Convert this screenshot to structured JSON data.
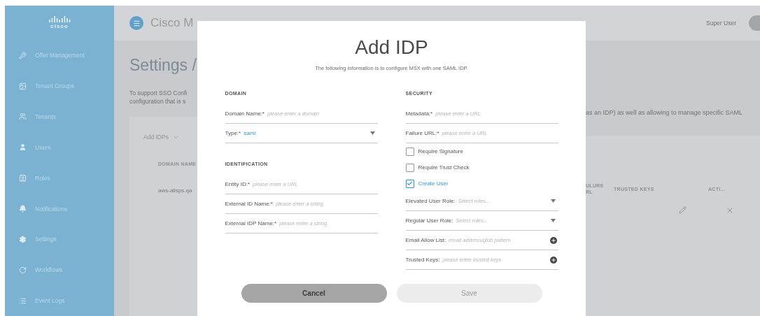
{
  "sidebar": {
    "logo": "cisco",
    "items": [
      {
        "label": "Offer Management"
      },
      {
        "label": "Tenant Groups"
      },
      {
        "label": "Tenants"
      },
      {
        "label": "Users"
      },
      {
        "label": "Roles"
      },
      {
        "label": "Notifications"
      },
      {
        "label": "Settings"
      },
      {
        "label": "Workflows"
      },
      {
        "label": "Event Logs"
      }
    ]
  },
  "header": {
    "title": "Cisco M",
    "user": "Super User"
  },
  "page": {
    "title": "Settings /",
    "description_left": [
      "To support SSO Confi",
      "configuration that is s"
    ],
    "description_right": "as an IDP) as well as allowing to manage specific SAML",
    "table": {
      "add_menu": "Add IDPs",
      "columns_left": [
        "DOMAIN NAME"
      ],
      "columns_right": [
        "ULURE RL",
        "TRUSTED KEYS",
        "ACTI..."
      ],
      "rows": [
        {
          "cell": "aws-allsps.qa"
        }
      ]
    }
  },
  "modal": {
    "title": "Add IDP",
    "subtitle": "The following information is to configure MSX with one SAML IDP.",
    "left_sections": [
      {
        "heading": "DOMAIN",
        "fields": [
          {
            "kind": "text",
            "label": "Domain Name:*",
            "placeholder": "please enter a domain"
          },
          {
            "kind": "select",
            "label": "Type:*",
            "value": "saml"
          }
        ]
      },
      {
        "heading": "IDENTIFICATION",
        "fields": [
          {
            "kind": "text",
            "label": "Entity ID:*",
            "placeholder": "please enter a URL"
          },
          {
            "kind": "text",
            "label": "External ID Name:*",
            "placeholder": "please enter a string"
          },
          {
            "kind": "text",
            "label": "External IDP Name:*",
            "placeholder": "please enter a string"
          }
        ]
      }
    ],
    "right_section": {
      "heading": "SECURITY",
      "fields": [
        {
          "kind": "text",
          "label": "Metadata:*",
          "placeholder": "please enter a URL"
        },
        {
          "kind": "text",
          "label": "Failure URL:*",
          "placeholder": "please enter a URL"
        },
        {
          "kind": "checkbox",
          "label": "Require Signature",
          "checked": false
        },
        {
          "kind": "checkbox",
          "label": "Require Trust Check",
          "checked": false
        },
        {
          "kind": "checkbox",
          "label": "Create User",
          "checked": true
        },
        {
          "kind": "select",
          "label": "Elevated User Role:",
          "placeholder": "Select roles..."
        },
        {
          "kind": "select",
          "label": "Regular User Role:",
          "placeholder": "Select roles..."
        },
        {
          "kind": "list",
          "label": "Email Allow List:",
          "placeholder": "email address/glob pattern"
        },
        {
          "kind": "list",
          "label": "Trusted Keys:",
          "placeholder": "please enter trusted keys"
        }
      ]
    },
    "buttons": [
      {
        "label": "Cancel",
        "kind": "secondary",
        "disabled": false
      },
      {
        "label": "Save",
        "kind": "primary",
        "disabled": true
      }
    ]
  }
}
